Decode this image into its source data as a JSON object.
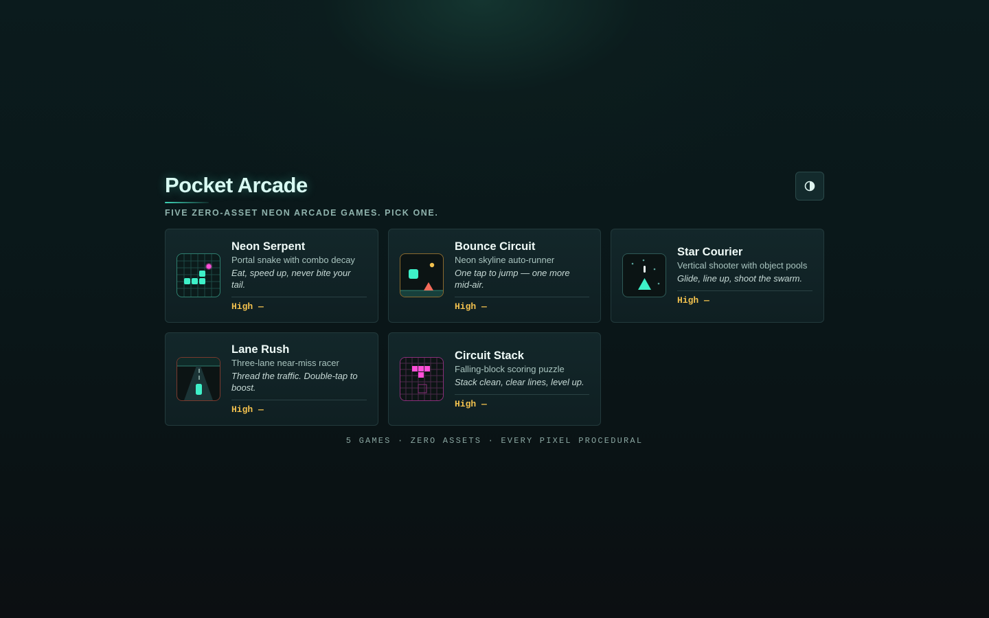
{
  "app": {
    "title": "Pocket Arcade",
    "tagline": "FIVE ZERO-ASSET NEON ARCADE GAMES. PICK ONE.",
    "theme_toggle_icon": "contrast-icon"
  },
  "games": [
    {
      "name": "Neon Serpent",
      "description": "Portal snake with combo decay",
      "tip": "Eat, speed up, never bite your tail.",
      "high_score": "High —",
      "thumb_icon": "snake-icon",
      "accent": "#3ef0c8"
    },
    {
      "name": "Bounce Circuit",
      "description": "Neon skyline auto-runner",
      "tip": "One tap to jump — one more mid-air.",
      "high_score": "High —",
      "thumb_icon": "runner-icon",
      "accent": "#e0a84a"
    },
    {
      "name": "Star Courier",
      "description": "Vertical shooter with object pools",
      "tip": "Glide, line up, shoot the swarm.",
      "high_score": "High —",
      "thumb_icon": "spaceship-icon",
      "accent": "#3ef0c8"
    },
    {
      "name": "Lane Rush",
      "description": "Three-lane near-miss racer",
      "tip": "Thread the traffic. Double-tap to boost.",
      "high_score": "High —",
      "thumb_icon": "road-icon",
      "accent": "#e0694a"
    },
    {
      "name": "Circuit Stack",
      "description": "Falling-block scoring puzzle",
      "tip": "Stack clean, clear lines, level up.",
      "high_score": "High —",
      "thumb_icon": "blocks-icon",
      "accent": "#ff4fd8"
    }
  ],
  "footer": "5 GAMES · ZERO ASSETS · EVERY PIXEL PROCEDURAL",
  "colors": {
    "accent_teal": "#3ef0c8",
    "high_score_gold": "#f2c14e",
    "accent_pink": "#ff4fd8"
  }
}
